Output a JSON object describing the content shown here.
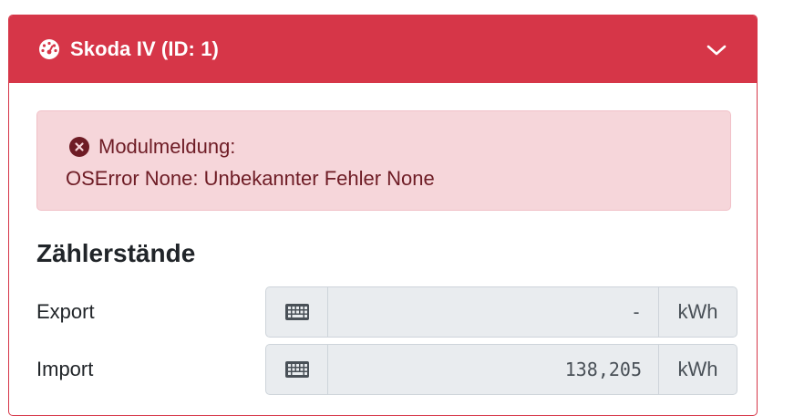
{
  "card": {
    "title": "Skoda IV (ID: 1)",
    "header_icon": "tachometer-icon",
    "toggle_icon": "chevron-down-icon",
    "accent_color": "#d63648"
  },
  "alert": {
    "icon": "circle-x-icon",
    "title": "Modulmeldung:",
    "message": "OSError None: Unbekannter Fehler None"
  },
  "counters": {
    "title": "Zählerstände",
    "rows": [
      {
        "label": "Export",
        "value": "-",
        "unit": "kWh",
        "icon": "keyboard-icon"
      },
      {
        "label": "Import",
        "value": "138,205",
        "unit": "kWh",
        "icon": "keyboard-icon"
      }
    ]
  }
}
